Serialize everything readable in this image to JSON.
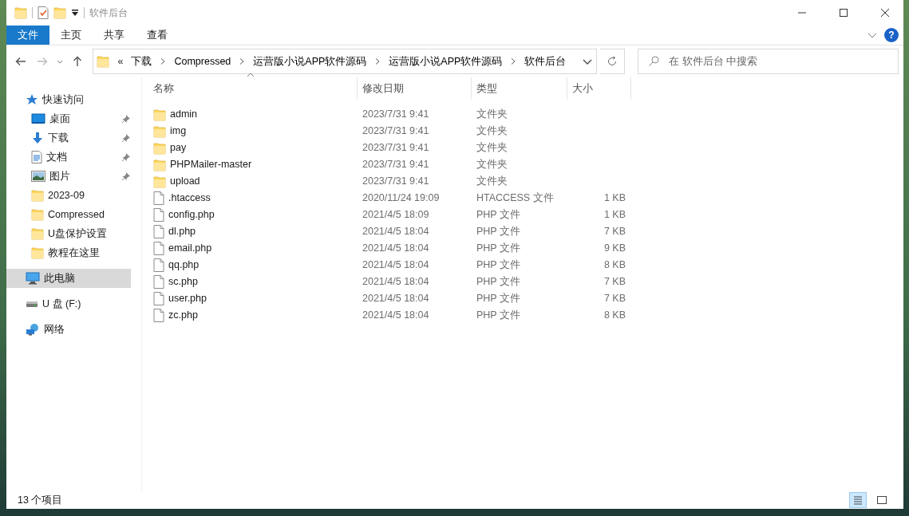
{
  "window": {
    "title": "软件后台",
    "help": "?"
  },
  "ribbon_tabs": [
    {
      "label": "文件",
      "selected": true
    },
    {
      "label": "主页",
      "selected": false
    },
    {
      "label": "共享",
      "selected": false
    },
    {
      "label": "查看",
      "selected": false
    }
  ],
  "address": {
    "overflow": "«",
    "segments": [
      "下载",
      "Compressed",
      "运营版小说APP软件源码",
      "运营版小说APP软件源码",
      "软件后台"
    ]
  },
  "search": {
    "placeholder": "在 软件后台 中搜索"
  },
  "sidebar": [
    {
      "kind": "star",
      "label": "快速访问",
      "pinned": false,
      "selected": false,
      "children": [
        {
          "kind": "desktop",
          "label": "桌面",
          "pinned": true,
          "selected": false
        },
        {
          "kind": "download",
          "label": "下载",
          "pinned": true,
          "selected": false
        },
        {
          "kind": "document",
          "label": "文档",
          "pinned": true,
          "selected": false
        },
        {
          "kind": "picture",
          "label": "图片",
          "pinned": true,
          "selected": false
        },
        {
          "kind": "folder",
          "label": "2023-09",
          "pinned": false,
          "selected": false
        },
        {
          "kind": "folder",
          "label": "Compressed",
          "pinned": false,
          "selected": false
        },
        {
          "kind": "folder",
          "label": "U盘保护设置",
          "pinned": false,
          "selected": false
        },
        {
          "kind": "folder",
          "label": "教程在这里",
          "pinned": false,
          "selected": false
        }
      ]
    },
    {
      "kind": "pc",
      "label": "此电脑",
      "pinned": false,
      "selected": true
    },
    {
      "kind": "drive",
      "label": "U 盘 (F:)",
      "pinned": false,
      "selected": false
    },
    {
      "kind": "network",
      "label": "网络",
      "pinned": false,
      "selected": false
    }
  ],
  "table": {
    "columns": [
      "名称",
      "修改日期",
      "类型",
      "大小"
    ],
    "rows": [
      {
        "kind": "folder",
        "name": "admin",
        "date": "2023/7/31 9:41",
        "type": "文件夹"
      },
      {
        "kind": "folder",
        "name": "img",
        "date": "2023/7/31 9:41",
        "type": "文件夹"
      },
      {
        "kind": "folder",
        "name": "pay",
        "date": "2023/7/31 9:41",
        "type": "文件夹"
      },
      {
        "kind": "folder",
        "name": "PHPMailer-master",
        "date": "2023/7/31 9:41",
        "type": "文件夹"
      },
      {
        "kind": "folder",
        "name": "upload",
        "date": "2023/7/31 9:41",
        "type": "文件夹"
      },
      {
        "kind": "file",
        "name": ".htaccess",
        "date": "2020/11/24 19:09",
        "type": "HTACCESS 文件",
        "size": "1 KB"
      },
      {
        "kind": "file",
        "name": "config.php",
        "date": "2021/4/5 18:09",
        "type": "PHP 文件",
        "size": "1 KB"
      },
      {
        "kind": "file",
        "name": "dl.php",
        "date": "2021/4/5 18:04",
        "type": "PHP 文件",
        "size": "7 KB"
      },
      {
        "kind": "file",
        "name": "email.php",
        "date": "2021/4/5 18:04",
        "type": "PHP 文件",
        "size": "9 KB"
      },
      {
        "kind": "file",
        "name": "qq.php",
        "date": "2021/4/5 18:04",
        "type": "PHP 文件",
        "size": "8 KB"
      },
      {
        "kind": "file",
        "name": "sc.php",
        "date": "2021/4/5 18:04",
        "type": "PHP 文件",
        "size": "7 KB"
      },
      {
        "kind": "file",
        "name": "user.php",
        "date": "2021/4/5 18:04",
        "type": "PHP 文件",
        "size": "7 KB"
      },
      {
        "kind": "file",
        "name": "zc.php",
        "date": "2021/4/5 18:04",
        "type": "PHP 文件",
        "size": "8 KB"
      }
    ]
  },
  "status_bar": {
    "count": "13 个项目",
    "views": [
      {
        "kind": "details",
        "selected": true
      },
      {
        "kind": "tiles",
        "selected": false
      }
    ]
  }
}
